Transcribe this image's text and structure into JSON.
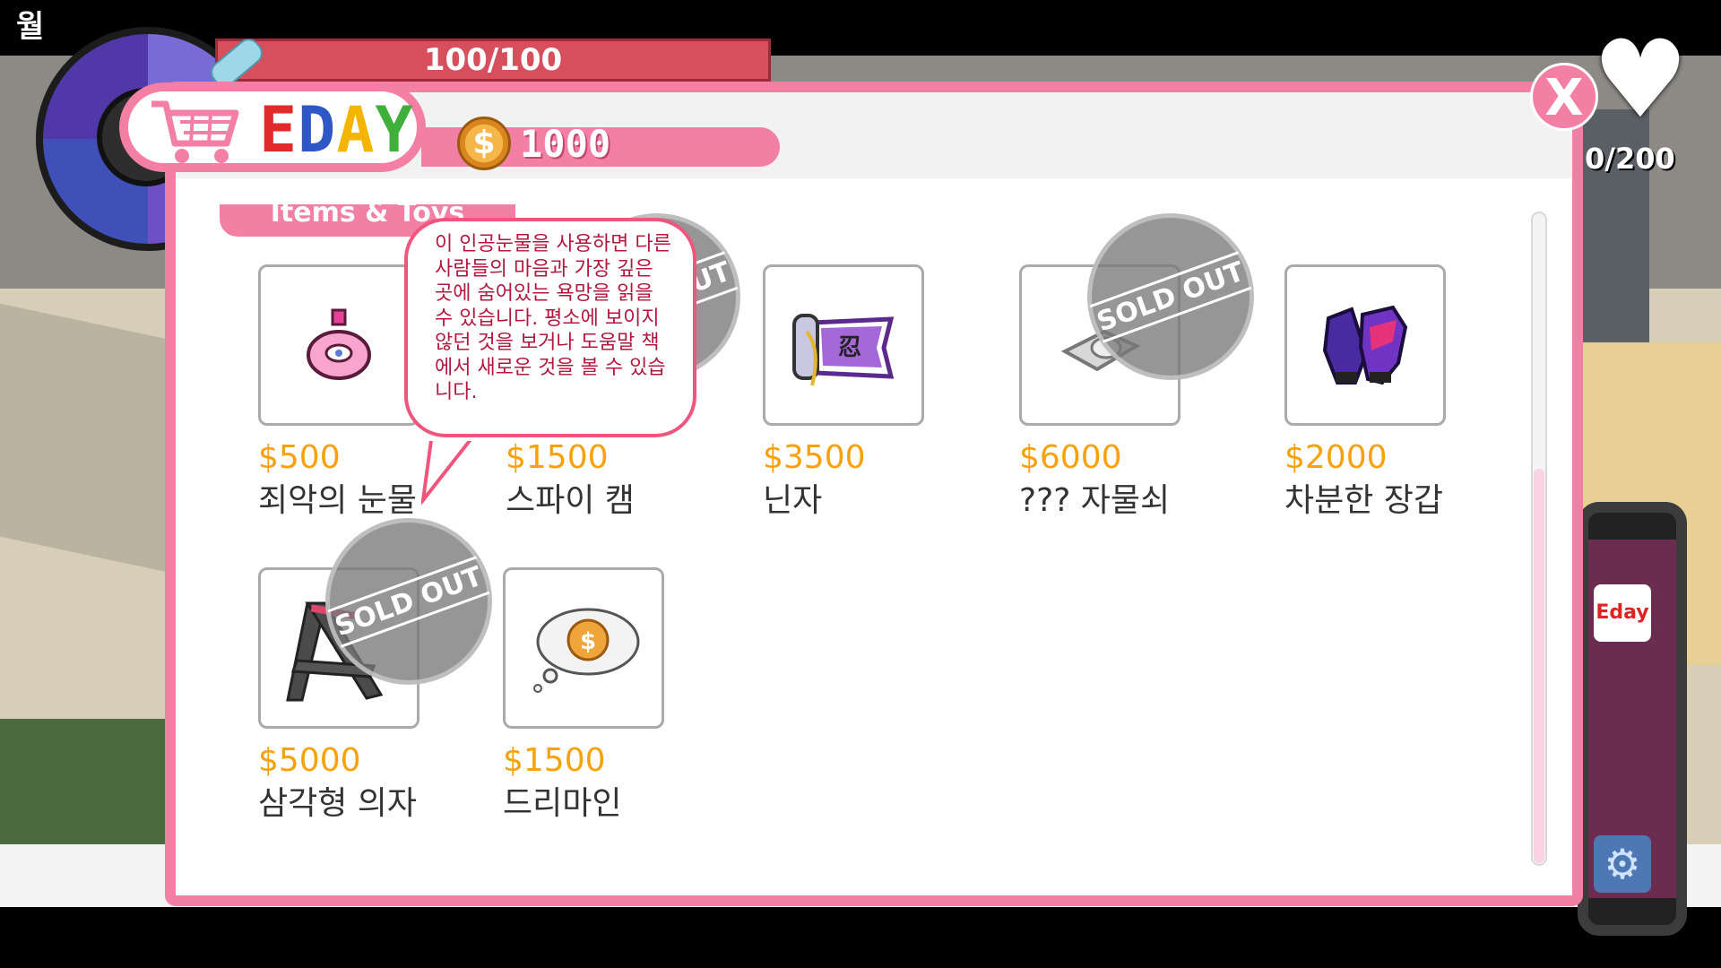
{
  "hud": {
    "weekday": "월",
    "hp_text": "100/100",
    "love_text": "0/200"
  },
  "phone": {
    "app_label": "Eday"
  },
  "shop": {
    "title_letters": [
      "E",
      "D",
      "A",
      "Y"
    ],
    "money": "1000",
    "close_label": "X",
    "category_label": "Items & Toys",
    "tooltip_text": "이 인공눈물을 사용하면 다른 사람들의 마음과 가장 깊은 곳에 숨어있는 욕망을 읽을 수 있습니다. 평소에 보이지 않던 것을 보거나 도움말 책에서 새로운 것을 볼 수 있습니다.",
    "soldout_label": "SOLD OUT",
    "items": [
      {
        "name": "죄악의 눈물",
        "price": "$500",
        "icon": "tear-potion-icon",
        "sold_out": false
      },
      {
        "name": "스파이 캠",
        "price": "$1500",
        "icon": "spy-cam-icon",
        "sold_out": true
      },
      {
        "name": "닌자",
        "price": "$3500",
        "icon": "ninja-scroll-icon",
        "sold_out": false
      },
      {
        "name": "??? 자물쇠",
        "price": "$6000",
        "icon": "lock-icon",
        "sold_out": true
      },
      {
        "name": "차분한 장갑",
        "price": "$2000",
        "icon": "gloves-icon",
        "sold_out": false
      },
      {
        "name": "삼각형 의자",
        "price": "$5000",
        "icon": "triangle-chair-icon",
        "sold_out": true
      },
      {
        "name": "드리마인",
        "price": "$1500",
        "icon": "dream-coin-icon",
        "sold_out": false
      }
    ]
  },
  "colors": {
    "accent_pink": "#f47fa5",
    "price_orange": "#f7a20c",
    "hp_red": "#d64f5c"
  }
}
